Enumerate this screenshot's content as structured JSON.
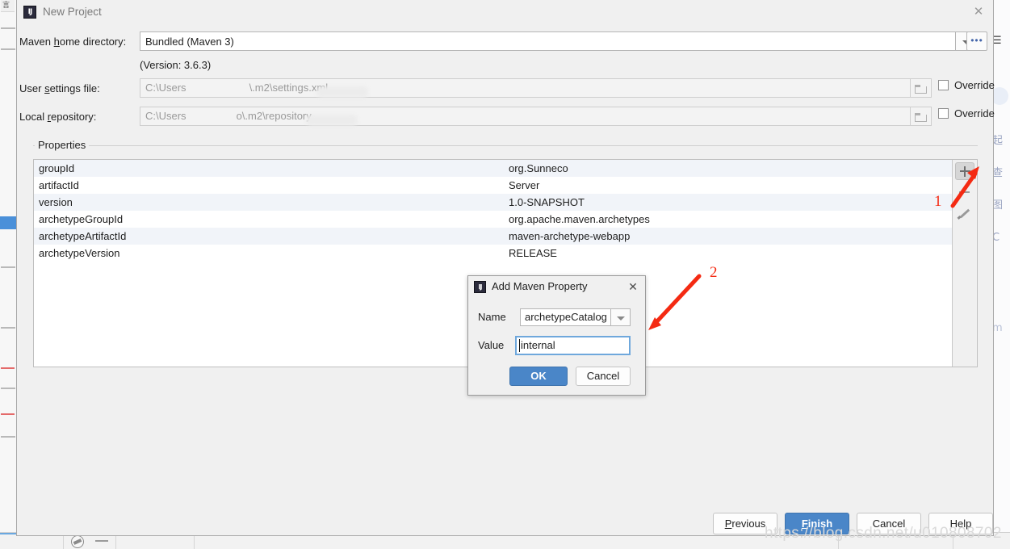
{
  "window": {
    "title": "New Project",
    "icon": "intellij-idea-icon",
    "close_label": "✕"
  },
  "form": {
    "maven_home": {
      "label_prefix": "Maven ",
      "label_underlined": "h",
      "label_suffix": "ome directory:",
      "label_full": "Maven home directory:",
      "value": "Bundled (Maven 3)",
      "browse_label": "•••"
    },
    "version_note": "(Version: 3.6.3)",
    "user_settings": {
      "label_full": "User settings file:",
      "value": "C:\\Users\\.m2\\settings.xml",
      "value_prefix": "C:\\Users",
      "value_suffix": "\\.m2\\settings.xml",
      "override_label": "Override",
      "override_checked": false
    },
    "local_repository": {
      "label_full": "Local repository:",
      "value": "C:\\Users\\.m2\\repository",
      "value_prefix": "C:\\Users",
      "value_suffix": "o\\.m2\\repository",
      "override_label": "Override",
      "override_checked": false
    }
  },
  "properties": {
    "legend": "Properties",
    "rows": [
      {
        "key": "groupId",
        "value": "org.Sunneco"
      },
      {
        "key": "artifactId",
        "value": "Server"
      },
      {
        "key": "version",
        "value": "1.0-SNAPSHOT"
      },
      {
        "key": "archetypeGroupId",
        "value": "org.apache.maven.archetypes"
      },
      {
        "key": "archetypeArtifactId",
        "value": "maven-archetype-webapp"
      },
      {
        "key": "archetypeVersion",
        "value": "RELEASE"
      }
    ],
    "toolbar": {
      "add": "+",
      "remove": "−",
      "edit": "pencil"
    }
  },
  "footer": {
    "previous": "Previous",
    "previous_mnemonic": "P",
    "finish": "Finish",
    "finish_mnemonic": "F",
    "cancel": "Cancel",
    "help": "Help"
  },
  "sub_dialog": {
    "title": "Add Maven Property",
    "icon": "intellij-idea-icon",
    "close_label": "✕",
    "name_label": "Name",
    "name_value": "archetypeCatalog",
    "value_label": "Value",
    "value_value": "internal",
    "ok": "OK",
    "cancel": "Cancel"
  },
  "annotations": [
    {
      "label": "1",
      "target": "add-property-button"
    },
    {
      "label": "2",
      "target": "add-maven-property-dialog"
    }
  ],
  "watermark": "https://blog.csdn.net/u010808702",
  "background": {
    "right_glyphs": [
      "起",
      "查",
      "图",
      "C"
    ],
    "left_glyph": "言"
  },
  "colors": {
    "accent": "#4a86c8",
    "annotation": "#f42a12",
    "row_stripe": "#f1f4f9",
    "dialog_bg": "#f0f0f0",
    "field_border": "#b5b5b5",
    "focus_border": "#6fa8dc"
  }
}
